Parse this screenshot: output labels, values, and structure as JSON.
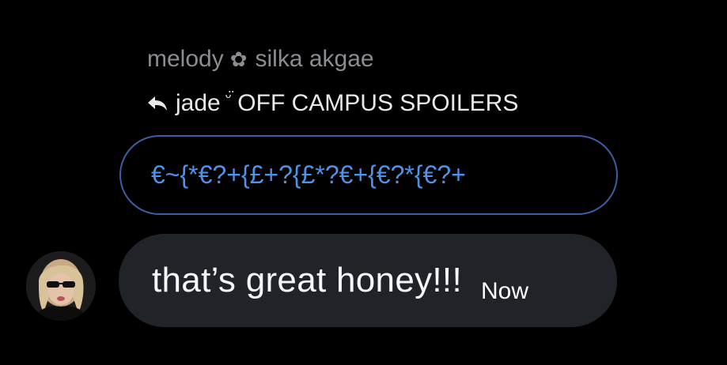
{
  "header": {
    "sender_name": "melody",
    "sender_separator_icon": "flower-icon",
    "sender_subname": "silka akgae"
  },
  "reply": {
    "icon": "reply-arrow-icon",
    "name": "jade",
    "emoticon": "ᵕ̈",
    "label": "OFF CAMPUS SPOILERS"
  },
  "quoted": {
    "text": "€~{*€?+{£+?{£*?€+{€?*{€?+",
    "border_color": "#3b5fa0",
    "text_color": "#4f93e8"
  },
  "message": {
    "text": "that’s great honey!!!",
    "timestamp": "Now",
    "bubble_color": "#202327"
  }
}
